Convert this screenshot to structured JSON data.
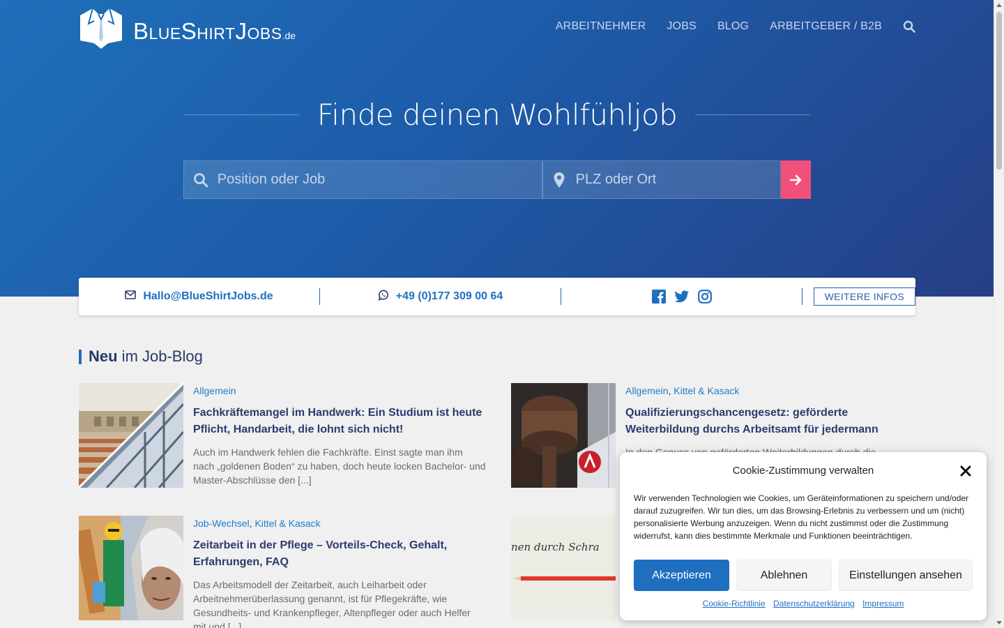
{
  "logo": {
    "text": "BlueShirtJobs",
    "tld": ".de"
  },
  "nav": {
    "items": [
      "ARBEITNEHMER",
      "JOBS",
      "BLOG",
      "ARBEITGEBER / B2B"
    ],
    "search_icon": "search-icon"
  },
  "hero": {
    "headline": "Finde deinen Wohlfühljob",
    "job_placeholder": "Position oder Job",
    "location_placeholder": "PLZ oder Ort"
  },
  "contact": {
    "email": "Hallo@BlueShirtJobs.de",
    "phone": "+49 (0)177 309 00 64",
    "social_icons": [
      "facebook-icon",
      "twitter-icon",
      "instagram-icon"
    ],
    "more_label": "WEITERE INFOS"
  },
  "blog": {
    "title_bold": "Neu",
    "title_rest": " im Job-Blog",
    "posts": [
      {
        "categories": [
          "Allgemein"
        ],
        "title": "Fachkräftemangel im Handwerk: Ein Studium ist heute Pflicht, Handarbeit, die lohnt sich nicht!",
        "excerpt": "Auch im Handwerk fehlen die Fachkräfte. Einst sagte man ihm nach „goldenen Boden“ zu haben, doch heute locken Bachelor- und Master-Abschlüsse den [...]"
      },
      {
        "categories": [
          "Allgemein",
          "Kittel & Kasack"
        ],
        "title": "Qualifizierungschancengesetz: geförderte Weiterbildung durchs Arbeitsamt für jedermann",
        "excerpt": "In den Genuss von geförderten Weiterbildungen durch die"
      },
      {
        "categories": [
          "Job-Wechsel",
          "Kittel & Kasack"
        ],
        "title": "Zeitarbeit in der Pflege – Vorteils-Check, Gehalt, Erfahrungen, FAQ",
        "excerpt": "Das Arbeitsmodell der Zeitarbeit, auch Leiharbeit oder Arbeitnehmerüberlassung genannt, ist für Pflegekräfte, wie Gesundheits- und Krankenpfleger, Altenpfleger oder auch Helfer mit und [...]"
      },
      {
        "categories": [],
        "title": "",
        "excerpt": "",
        "thumb_text": "nen durch Schra"
      }
    ]
  },
  "cookie": {
    "title": "Cookie-Zustimmung verwalten",
    "text": "Wir verwenden Technologien wie Cookies, um Geräteinformationen zu speichern und/oder darauf zuzugreifen. Wir tun dies, um das Browsing-Erlebnis zu verbessern und um (nicht) personalisierte Werbung anzuzeigen. Wenn du nicht zustimmst oder die Zustimmung widerrufst, kann dies bestimmte Merkmale und Funktionen beeinträchtigen.",
    "accept": "Akzeptieren",
    "deny": "Ablehnen",
    "preferences": "Einstellungen ansehen",
    "links": [
      "Cookie-Richtlinie",
      "Datenschutzerklärung",
      "Impressum"
    ]
  },
  "colors": {
    "accent": "#1e6fc0",
    "submit": "#f0507a",
    "title": "#2c3a6e"
  }
}
